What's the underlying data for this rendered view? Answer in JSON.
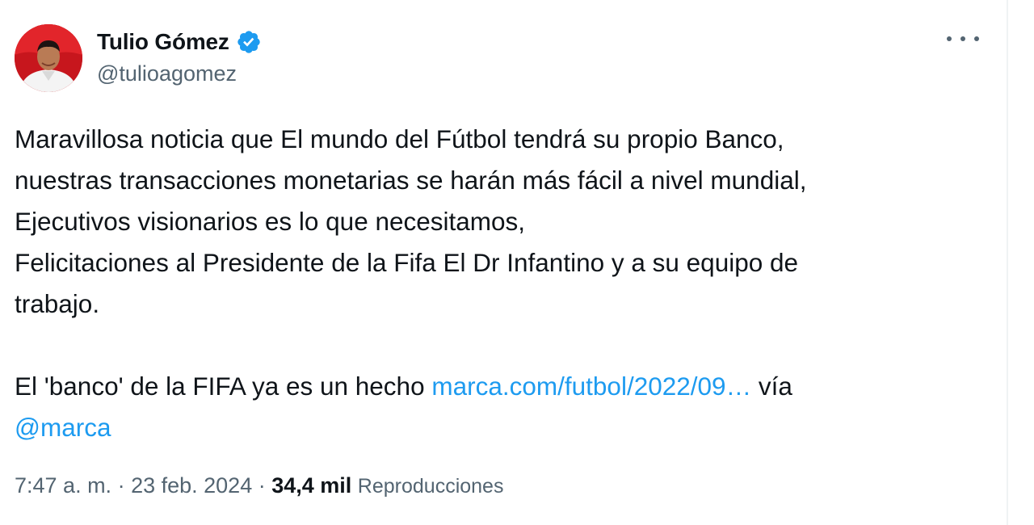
{
  "author": {
    "display_name": "Tulio Gómez",
    "handle": "@tulioagomez",
    "verified_icon": "verified-badge-icon",
    "avatar_icon": "avatar-photo"
  },
  "menu": {
    "more_icon": "more-options-icon"
  },
  "tweet": {
    "lines": [
      "Maravillosa noticia que El mundo del Fútbol tendrá su propio Banco,",
      "nuestras transacciones monetarias se harán más fácil a nivel mundial,",
      "Ejecutivos visionarios es lo que necesitamos,",
      "Felicitaciones al Presidente de la Fifa El Dr Infantino y a su equipo de",
      "trabajo."
    ],
    "share_prefix": "El 'banco' de la FIFA ya es un hecho ",
    "share_link": "marca.com/futbol/2022/09…",
    "share_via": " vía",
    "mention": "@marca"
  },
  "meta": {
    "time": "7:47 a. m.",
    "separator": " · ",
    "date": "23 feb. 2024",
    "views_count": "34,4 mil",
    "views_label": "Reproducciones"
  },
  "colors": {
    "link": "#1d9bf0",
    "verified": "#1d9bf0",
    "secondary_text": "#536471",
    "primary_text": "#0f1419",
    "avatar_bg": "#c7161d"
  }
}
